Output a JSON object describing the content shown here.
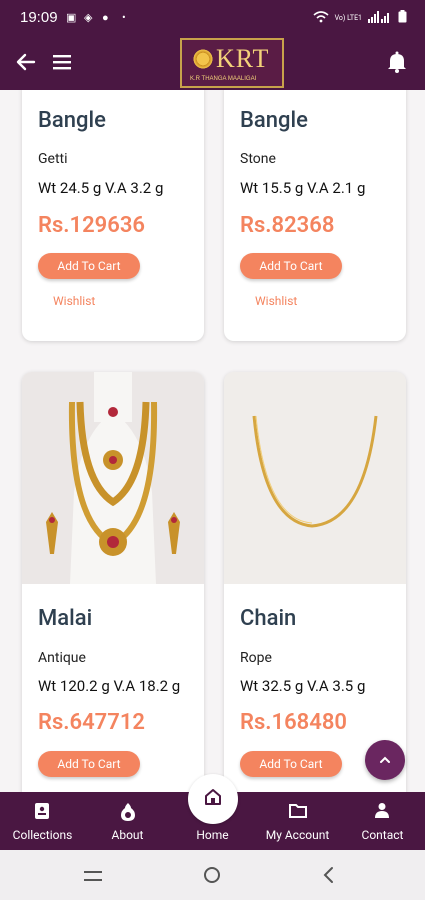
{
  "status": {
    "time": "19:09",
    "network": "Vo) LTE1"
  },
  "header": {
    "logo_text": "KRT",
    "logo_sub": "K.R THANGA MAALIGAI"
  },
  "products": [
    {
      "title": "Bangle",
      "type": "Getti",
      "weight": "Wt 24.5 g V.A 3.2 g",
      "price": "Rs.129636",
      "cart": "Add To Cart",
      "wishlist": "Wishlist"
    },
    {
      "title": "Bangle",
      "type": "Stone",
      "weight": "Wt 15.5 g V.A 2.1 g",
      "price": "Rs.82368",
      "cart": "Add To Cart",
      "wishlist": "Wishlist"
    },
    {
      "title": "Malai",
      "type": "Antique",
      "weight": "Wt 120.2 g V.A 18.2 g",
      "price": "Rs.647712",
      "cart": "Add To Cart"
    },
    {
      "title": "Chain",
      "type": "Rope",
      "weight": "Wt 32.5 g V.A 3.5 g",
      "price": "Rs.168480",
      "cart": "Add To Cart"
    }
  ],
  "nav": {
    "collections": "Collections",
    "about": "About",
    "home": "Home",
    "account": "My Account",
    "contact": "Contact"
  },
  "colors": {
    "brand": "#4a1742",
    "accent": "#f4845f",
    "title": "#2f4050"
  }
}
